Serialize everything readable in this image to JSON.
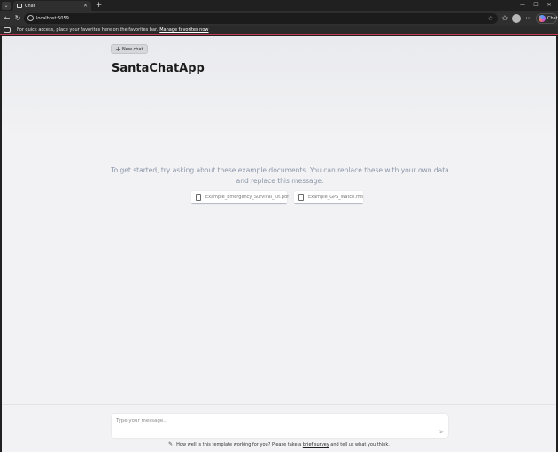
{
  "browser": {
    "tab_title": "Chat",
    "url": "localhost:5059",
    "copilot_label": "Chat",
    "favorites_text": "For quick access, place your favorites here on the favorites bar.",
    "favorites_link": "Manage favorites now"
  },
  "page": {
    "new_chat_label": "New chat",
    "app_title": "SantaChatApp",
    "intro_text": "To get started, try asking about these example documents. You can replace these with your own data and replace this message.",
    "documents": [
      "Example_Emergency_Survival_Kit.pdf",
      "Example_GPS_Watch.md"
    ],
    "input_placeholder": "Type your message...",
    "feedback_before": "How well is this template working for you? Please take a",
    "feedback_link": "brief survey",
    "feedback_after": "and tell us what you think."
  },
  "icons": {
    "tab_menu": "chevron-down-icon",
    "tab": "chat-window-icon",
    "close": "close-icon",
    "new_tab": "plus-icon",
    "back": "back-arrow-icon",
    "refresh": "refresh-icon",
    "site_info": "info-icon",
    "favorite": "star-icon",
    "document": "document-icon",
    "send": "send-icon",
    "feedback": "pencil-icon"
  },
  "colors": {
    "favorites_accent": "#c43a55",
    "intro_text": "#8a96a8"
  }
}
